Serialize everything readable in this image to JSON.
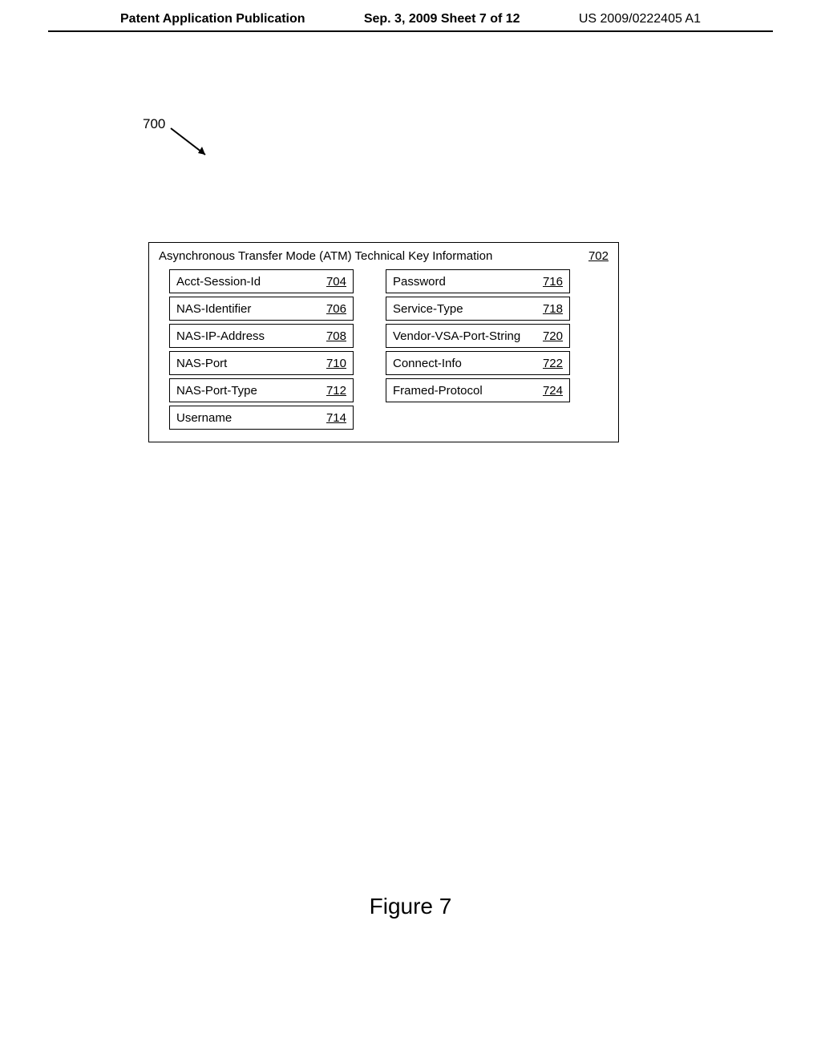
{
  "header": {
    "left": "Patent Application Publication",
    "center": "Sep. 3, 2009  Sheet 7 of 12",
    "right": "US 2009/0222405 A1"
  },
  "diagram": {
    "ref_label": "700",
    "main_box": {
      "title": "Asynchronous Transfer Mode (ATM) Technical Key Information",
      "ref": "702",
      "left_col": [
        {
          "name": "Acct-Session-Id",
          "ref": "704"
        },
        {
          "name": "NAS-Identifier",
          "ref": "706"
        },
        {
          "name": "NAS-IP-Address",
          "ref": "708"
        },
        {
          "name": "NAS-Port",
          "ref": "710"
        },
        {
          "name": "NAS-Port-Type",
          "ref": "712"
        },
        {
          "name": "Username",
          "ref": "714"
        }
      ],
      "right_col": [
        {
          "name": "Password",
          "ref": "716"
        },
        {
          "name": "Service-Type",
          "ref": "718"
        },
        {
          "name": "Vendor-VSA-Port-String",
          "ref": "720"
        },
        {
          "name": "Connect-Info",
          "ref": "722"
        },
        {
          "name": "Framed-Protocol",
          "ref": "724"
        }
      ]
    }
  },
  "figure_caption": "Figure 7"
}
